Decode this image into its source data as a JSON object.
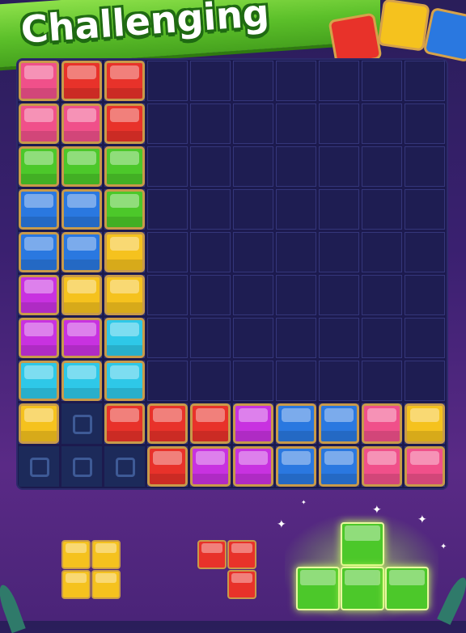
{
  "banner": {
    "title": "Challenging"
  },
  "colors": {
    "red": "#e8322a",
    "pink": "#f0508a",
    "green": "#4cc82a",
    "blue": "#2a78e0",
    "yellow": "#f5c21e",
    "purple": "#c832e0",
    "cyan": "#2ec8e8"
  },
  "board": {
    "rows": 10,
    "cols": 10,
    "cells": [
      [
        "pink",
        "red",
        "red",
        null,
        null,
        null,
        null,
        null,
        null,
        null
      ],
      [
        "pink",
        "pink",
        "red",
        null,
        null,
        null,
        null,
        null,
        null,
        null
      ],
      [
        "green",
        "green",
        "green",
        null,
        null,
        null,
        null,
        null,
        null,
        null
      ],
      [
        "blue",
        "blue",
        "green",
        null,
        null,
        null,
        null,
        null,
        null,
        null
      ],
      [
        "blue",
        "blue",
        "yellow",
        null,
        null,
        null,
        null,
        null,
        null,
        null
      ],
      [
        "purple",
        "yellow",
        "yellow",
        null,
        null,
        null,
        null,
        null,
        null,
        null
      ],
      [
        "purple",
        "purple",
        "cyan",
        null,
        null,
        null,
        null,
        null,
        null,
        null
      ],
      [
        "cyan",
        "cyan",
        "cyan",
        null,
        null,
        null,
        null,
        null,
        null,
        null
      ],
      [
        "yellow",
        "slot",
        "red",
        "red",
        "red",
        "purple",
        "blue",
        "blue",
        "pink",
        "yellow"
      ],
      [
        "slot",
        "slot",
        "slot",
        "red",
        "purple",
        "purple",
        "blue",
        "blue",
        "pink",
        "pink"
      ]
    ]
  },
  "pieces": [
    {
      "name": "piece-yellow-square",
      "color": "yellow",
      "cells": [
        [
          0,
          0
        ],
        [
          0,
          1
        ],
        [
          1,
          0
        ],
        [
          1,
          1
        ]
      ]
    },
    {
      "name": "piece-red-corner",
      "color": "red",
      "cells": [
        [
          0,
          0
        ],
        [
          0,
          1
        ],
        [
          1,
          1
        ]
      ]
    },
    {
      "name": "piece-green-t",
      "color": "green",
      "selected": true,
      "cells": [
        [
          0,
          1
        ],
        [
          1,
          0
        ],
        [
          1,
          1
        ],
        [
          1,
          2
        ]
      ]
    }
  ]
}
